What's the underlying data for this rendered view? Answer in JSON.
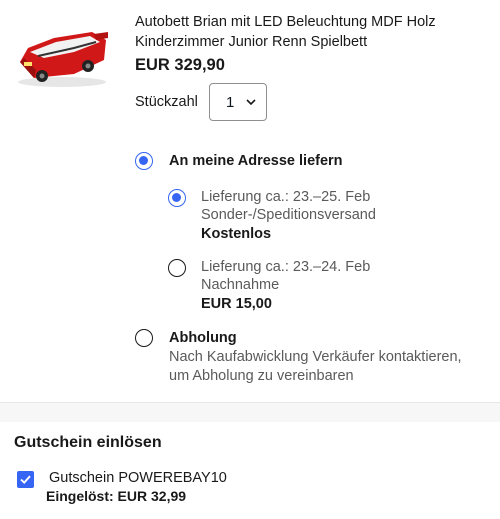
{
  "product": {
    "title": "Autobett Brian mit LED Beleuchtung MDF Holz Kinderzimmer Junior Renn Spielbett",
    "price": "EUR 329,90",
    "image_icon": "race-car-bed-image"
  },
  "quantity": {
    "label": "Stückzahl",
    "value": "1"
  },
  "delivery": {
    "home": {
      "label": "An meine Adresse liefern",
      "selected": true,
      "options": [
        {
          "line1": "Lieferung ca.: 23.–25. Feb",
          "line2": "Sonder-/Speditionsversand",
          "cost": "Kostenlos",
          "selected": true
        },
        {
          "line1": "Lieferung ca.: 23.–24. Feb",
          "line2": "Nachnahme",
          "cost": "EUR 15,00",
          "selected": false
        }
      ]
    },
    "pickup": {
      "label": "Abholung",
      "line1": "Nach Kaufabwicklung Verkäufer kontaktieren,",
      "line2": "um Abholung zu vereinbaren",
      "selected": false
    }
  },
  "coupon": {
    "section_title": "Gutschein einlösen",
    "name": "Gutschein POWEREBAY10",
    "applied": "Eingelöst: EUR 32,99",
    "checked": true
  },
  "colors": {
    "accent": "#3665f3",
    "text": "#191919",
    "muted": "#5a5a5a"
  }
}
